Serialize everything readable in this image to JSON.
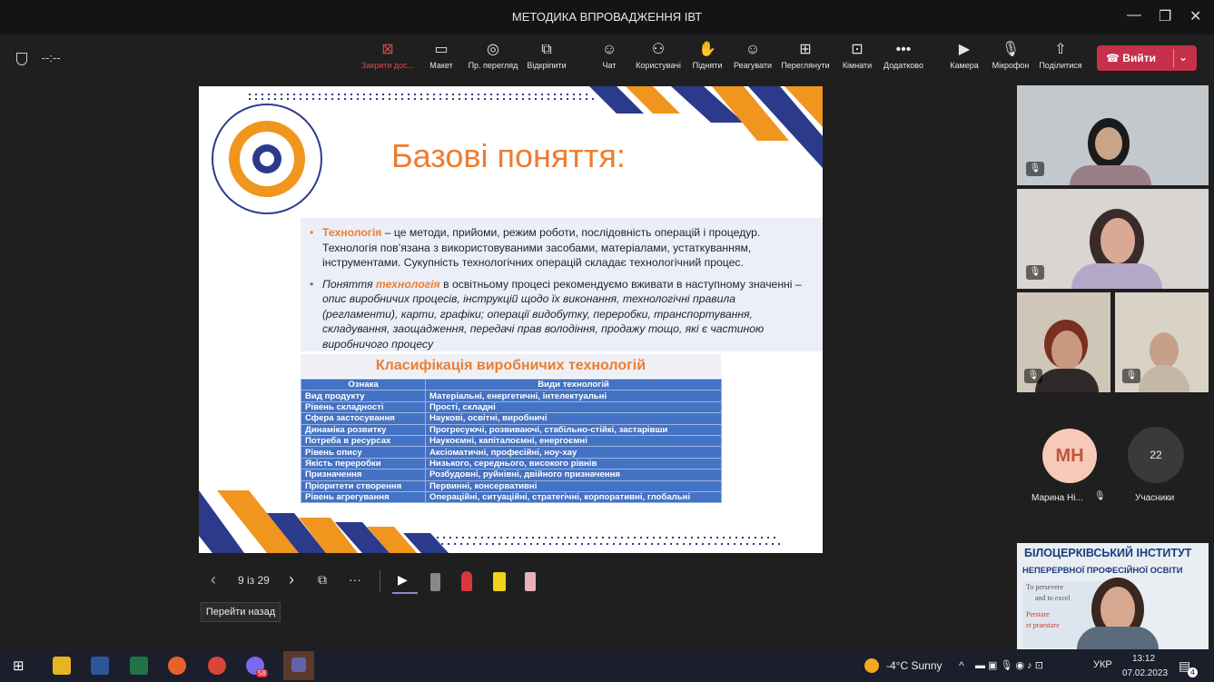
{
  "window": {
    "title": "МЕТОДИКА ВПРОВАДЖЕННЯ ІВТ",
    "min": "—",
    "max": "❐",
    "close": "✕"
  },
  "toolbar": {
    "timer": "--:--",
    "buttons": [
      {
        "label": "Закрити дос...",
        "icon": "close-share-icon",
        "glyph": "⊠"
      },
      {
        "label": "Макет",
        "icon": "layout-icon",
        "glyph": "▭"
      },
      {
        "label": "Пр. перегляд",
        "icon": "eye-icon",
        "glyph": "◎"
      },
      {
        "label": "Відкріпити",
        "icon": "popout-icon",
        "glyph": "⧉"
      },
      {
        "label": "Чат",
        "icon": "chat-icon",
        "glyph": "☺"
      },
      {
        "label": "Користувачі",
        "icon": "people-icon",
        "glyph": "⚇"
      },
      {
        "label": "Підняти",
        "icon": "hand-icon",
        "glyph": "✋"
      },
      {
        "label": "Реагувати",
        "icon": "smiley-icon",
        "glyph": "☺"
      },
      {
        "label": "Переглянути",
        "icon": "grid-icon",
        "glyph": "⊞"
      },
      {
        "label": "Кімнати",
        "icon": "rooms-icon",
        "glyph": "⊡"
      },
      {
        "label": "Додатково",
        "icon": "more-icon",
        "glyph": "•••"
      },
      {
        "label": "Камера",
        "icon": "camera-icon",
        "glyph": "▶"
      },
      {
        "label": "Мікрофон",
        "icon": "mic-icon",
        "glyph": "🎙"
      },
      {
        "label": "Поділитися",
        "icon": "share-icon",
        "glyph": "⇧"
      }
    ],
    "leave": "Вийти"
  },
  "slide": {
    "title": "Базові поняття:",
    "bullet1": {
      "term": "Технологія",
      "text": " – це методи, прийоми, режим роботи, послідовність операцій і процедур. Технологія пов’язана з використовуваними засобами, матеріалами, устаткуванням, інструментами. Сукупність технологічних операцій складає технологічний процес."
    },
    "bullet2": {
      "p1": "Поняття ",
      "term": "технологія",
      "p2": " в освітньому процесі рекомендуємо вживати в наступному значенні – ",
      "p3": "опис виробничих процесів, інструкцій щодо їх виконання, технологічні правила (регламенти), карти, графіки; операції видобутку, переробки, транспортування, складування, заощадження, передачі прав володіння, продажу тощо, які є частиною виробничого процесу"
    },
    "class_title": "Класифікація виробничих технологій",
    "table": {
      "headers": [
        "Ознака",
        "Види технологій"
      ],
      "rows": [
        [
          "Вид продукту",
          "Матеріальні, енергетичні, інтелектуальні"
        ],
        [
          "Рівень складності",
          "Прості, складні"
        ],
        [
          "Сфера застосування",
          "Наукові, освітні, виробничі"
        ],
        [
          "Динаміка розвитку",
          "Прогресуючі, розвиваючі, стабільно-стійкі, застарівши"
        ],
        [
          "Потреба в ресурсах",
          "Наукоємні, капіталоємні, енергоємні"
        ],
        [
          "Рівень опису",
          "Аксіоматичні, професійні, ноу-хау"
        ],
        [
          "Якість переробки",
          "Низького, середнього, високого рівнів"
        ],
        [
          "Призначення",
          "Розбудовні, руйнівні, двійного призначення"
        ],
        [
          "Пріоритети створення",
          "Первинні, консервативні"
        ],
        [
          "Рівень агрегування",
          "Операційні, ситуаційні, стратегічні, корпоративні, глобальні"
        ]
      ]
    }
  },
  "presenter": {
    "prev": "‹",
    "page": "9 із 29",
    "next": "›",
    "more": "···",
    "tooltip": "Перейти назад"
  },
  "participants": {
    "mh_initials": "МН",
    "mh_name": "Марина Ні...",
    "count": "22",
    "count_label": "Учасники",
    "banner_line1": "БІЛОЦЕРКІВСЬКИЙ ІНСТИТУТ",
    "banner_line2": "НЕПЕРЕРВНОЇ ПРОФЕСІЙНОЇ ОСВІТИ",
    "banner_small1": "To persevere",
    "banner_small2": "and to excel",
    "banner_small3": "Perstare",
    "banner_small4": "et praestare"
  },
  "taskbar": {
    "weather": "-4°C  Sunny",
    "lang": "УКР",
    "time": "13:12",
    "date": "07.02.2023",
    "badge_notif": "4",
    "badge_58": "58"
  }
}
